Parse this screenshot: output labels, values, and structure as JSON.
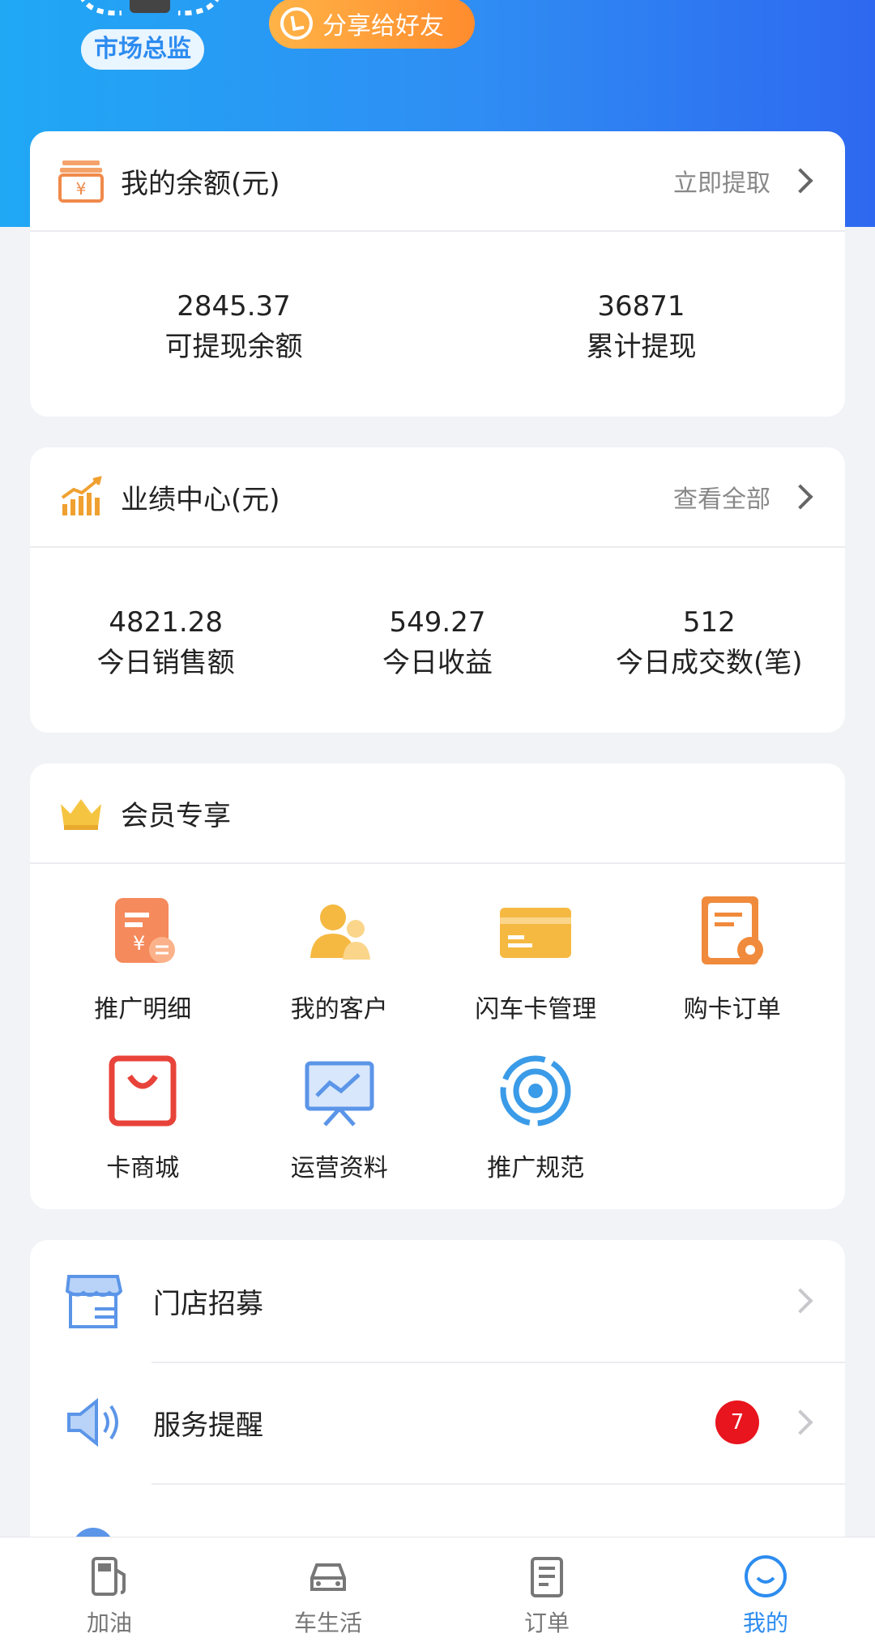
{
  "header": {
    "level_badge": "市场总监",
    "share_label": "分享给好友",
    "colors": {
      "gradient_start": "#20a8f5",
      "gradient_end": "#2e68f0"
    }
  },
  "balance": {
    "title": "我的余额(元)",
    "action": "立即提取",
    "icon": "wallet-icon",
    "stats": [
      {
        "value": "2845.37",
        "label": "可提现余额"
      },
      {
        "value": "36871",
        "label": "累计提现"
      }
    ]
  },
  "performance": {
    "title": "业绩中心(元)",
    "action": "查看全部",
    "icon": "chart-bars-icon",
    "stats": [
      {
        "value": "4821.28",
        "label": "今日销售额"
      },
      {
        "value": "549.27",
        "label": "今日收益"
      },
      {
        "value": "512",
        "label": "今日成交数(笔)"
      }
    ]
  },
  "member": {
    "title": "会员专享",
    "icon": "crown-icon",
    "items": [
      {
        "label": "推广明细",
        "icon": "promo-detail-icon"
      },
      {
        "label": "我的客户",
        "icon": "customers-icon"
      },
      {
        "label": "闪车卡管理",
        "icon": "card-manage-icon"
      },
      {
        "label": "购卡订单",
        "icon": "card-order-icon"
      },
      {
        "label": "卡商城",
        "icon": "shopping-bag-icon"
      },
      {
        "label": "运营资料",
        "icon": "presentation-icon"
      },
      {
        "label": "推广规范",
        "icon": "target-icon"
      }
    ]
  },
  "list": {
    "rows": [
      {
        "label": "门店招募",
        "icon": "store-icon"
      },
      {
        "label": "服务提醒",
        "icon": "speaker-icon",
        "badge": "7"
      }
    ]
  },
  "tabbar": {
    "tabs": [
      {
        "label": "加油",
        "icon": "fuel-icon"
      },
      {
        "label": "车生活",
        "icon": "car-icon"
      },
      {
        "label": "订单",
        "icon": "order-icon"
      },
      {
        "label": "我的",
        "icon": "smile-icon",
        "active": true
      }
    ],
    "active_color": "#2d8cf0"
  }
}
